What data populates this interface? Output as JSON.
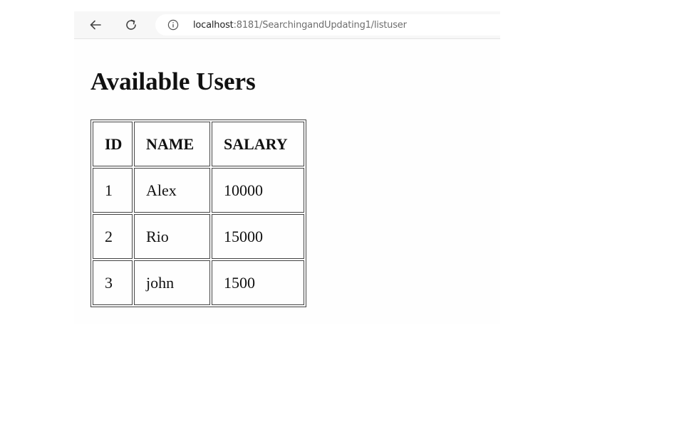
{
  "browser": {
    "url_host": "localhost",
    "url_path": ":8181/SearchingandUpdating1/listuser"
  },
  "page": {
    "title": "Available Users"
  },
  "table": {
    "headers": [
      "ID",
      "NAME",
      "SALARY"
    ],
    "rows": [
      [
        "1",
        "Alex",
        "10000"
      ],
      [
        "2",
        "Rio",
        "15000"
      ],
      [
        "3",
        "john",
        "1500"
      ]
    ]
  },
  "icons": {
    "back": "arrow-left-icon",
    "reload": "reload-icon",
    "info": "info-icon"
  },
  "colors": {
    "toolbar_bg": "#f7f7f7",
    "border": "#444444",
    "text": "#111111"
  }
}
